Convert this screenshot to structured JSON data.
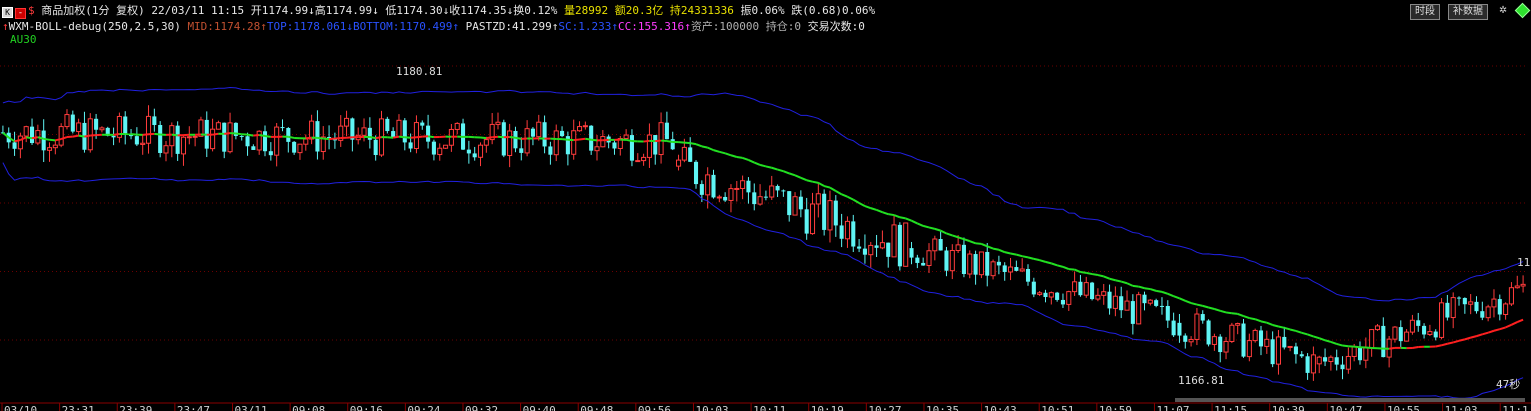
{
  "header": {
    "k_icon": "K",
    "minus_icon": "-",
    "dollar_icon": "$",
    "symbol_name": "商品加权(1分 复权)",
    "datetime": "22/03/11 11:15",
    "open_label": "开",
    "open_value": "1174.99",
    "high_label": "高",
    "high_value": "1174.99",
    "low_label": "低",
    "low_value": "1174.30",
    "close_label": "收",
    "close_value": "1174.35",
    "turnover_label": "换",
    "turnover_value": "0.12%",
    "volume_label": "量",
    "volume_value": "28992",
    "amount_label": "额",
    "amount_value": "20.3亿",
    "hold_label": "持",
    "hold_value": "24331336",
    "amplitude_label": "振",
    "amplitude_value": "0.06%",
    "fall_label": "跌",
    "fall_value": "(0.68)0.06%",
    "btn_time": "时段",
    "btn_fill": "补数据"
  },
  "indicator": {
    "name": "WXM-BOLL-debug(250,2.5,30)",
    "mid": "MID:1174.28",
    "top": "TOP:1178.061",
    "bottom": "BOTTOM:1170.499",
    "pastzd": "PASTZD:41.299",
    "sc": "SC:1.233",
    "cc": "CC:155.316",
    "asset": "资产:100000",
    "position": "持仓:0",
    "trades": "交易次数:0",
    "sub": "AU30"
  },
  "chart_data": {
    "type": "candlestick",
    "high_label": "1180.81",
    "low_label": "1166.81",
    "right_label": "11",
    "countdown": "47秒",
    "x_ticks": [
      "03/10",
      "23:31",
      "23:39",
      "23:47",
      "03/11",
      "09:08",
      "09:16",
      "09:24",
      "09:32",
      "09:40",
      "09:48",
      "09:56",
      "10:03",
      "10:11",
      "10:19",
      "10:27",
      "10:35",
      "10:43",
      "10:51",
      "10:59",
      "11:07",
      "11:15",
      "10:39",
      "10:47",
      "10:55",
      "11:03",
      "11:1"
    ],
    "colors": {
      "up": "#ff3c3c",
      "down": "#5ff5f5",
      "mid_up": "#ff2020",
      "mid_down": "#22e022",
      "band": "#2020e0"
    },
    "segments": [
      {
        "from": 0,
        "to": 116,
        "start": 1177.4,
        "end": 1177.0,
        "range": 1.0
      },
      {
        "from": 116,
        "to": 156,
        "start": 1176.0,
        "end": 1172.6,
        "range": 1.2
      },
      {
        "from": 156,
        "to": 202,
        "start": 1172.6,
        "end": 1169.5,
        "range": 0.9
      },
      {
        "from": 202,
        "to": 226,
        "start": 1169.5,
        "end": 1167.8,
        "range": 0.9
      },
      {
        "from": 226,
        "to": 262,
        "start": 1167.8,
        "end": 1171.0,
        "range": 0.9
      }
    ],
    "y_range": [
      1166.3,
      1180.9
    ]
  }
}
